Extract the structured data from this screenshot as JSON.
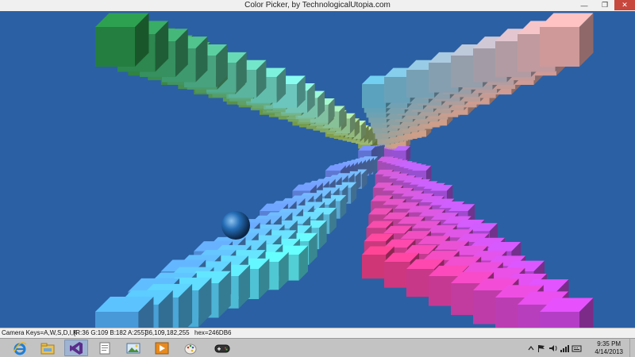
{
  "window": {
    "title": "Color Picker, by TechnologicalUtopia.com",
    "minimize_glyph": "—",
    "maximize_glyph": "❐",
    "close_glyph": "✕"
  },
  "status": {
    "camera_keys": "Camera Keys=A,W,S,D,I,K",
    "rgba": "[R:36 G:109 B:182 A:255]",
    "rgb_csv": "36,109,182,255",
    "hex": "hex=246DB6",
    "selected_color": "#246DB6"
  },
  "taskbar": {
    "apps": [
      {
        "icon": "internet-explorer-icon"
      },
      {
        "icon": "file-explorer-icon"
      },
      {
        "icon": "visual-studio-icon",
        "active": true
      },
      {
        "icon": "document-icon"
      },
      {
        "icon": "image-viewer-icon"
      },
      {
        "icon": "media-player-icon"
      },
      {
        "icon": "paint-icon"
      },
      {
        "icon": "game-controller-icon"
      }
    ],
    "tray_icons": [
      "flag-icon",
      "speaker-icon",
      "network-icon",
      "keyboard-icon"
    ],
    "time": "9:35 PM",
    "date": "4/14/2013"
  }
}
